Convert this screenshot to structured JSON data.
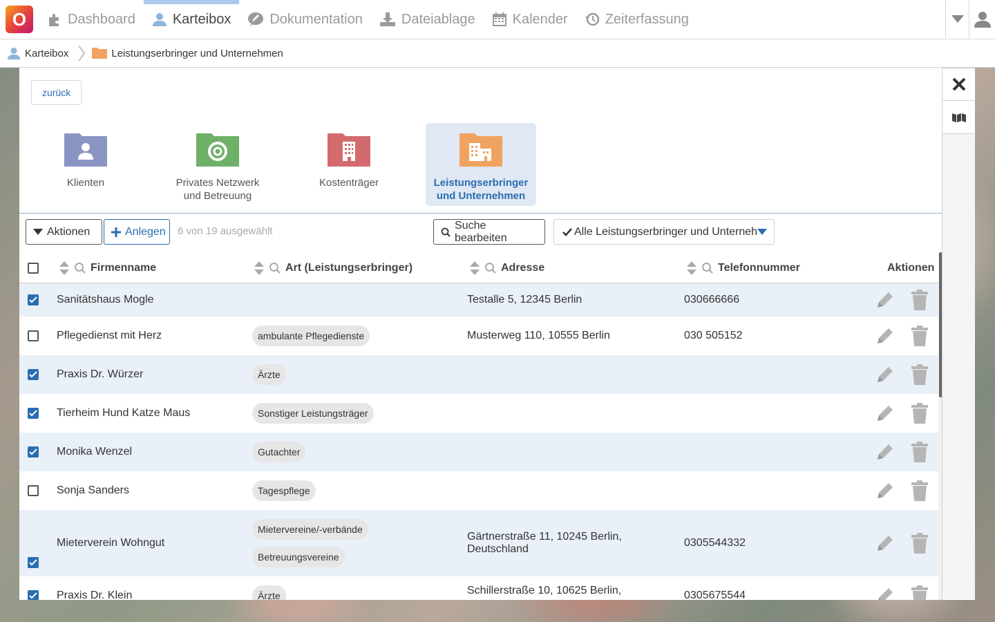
{
  "app": {
    "logo_letter": "O"
  },
  "topnav": {
    "items": [
      {
        "label": "Dashboard",
        "icon": "puzzle-icon"
      },
      {
        "label": "Karteibox",
        "icon": "user-icon",
        "active": true
      },
      {
        "label": "Dokumentation",
        "icon": "pencil-bubble-icon"
      },
      {
        "label": "Dateiablage",
        "icon": "download-icon"
      },
      {
        "label": "Kalender",
        "icon": "calendar-icon"
      },
      {
        "label": "Zeiterfassung",
        "icon": "history-icon"
      }
    ]
  },
  "breadcrumb": {
    "items": [
      {
        "label": "Karteibox"
      },
      {
        "label": "Leistungserbringer und Unternehmen"
      }
    ]
  },
  "back_label": "zurück",
  "categories": [
    {
      "label": "Klienten",
      "color": "#8a95c3"
    },
    {
      "label": "Privates Netzwerk und Betreuung",
      "color": "#6fb068"
    },
    {
      "label": "Kostenträger",
      "color": "#d36b6e"
    },
    {
      "label": "Leistungserbringer und Unternehmen",
      "color": "#f0a35e",
      "active": true
    }
  ],
  "toolbar": {
    "actions_label": "Aktionen",
    "create_label": "Anlegen",
    "selection_text": "6 von 19 ausgewählt",
    "search_label": "Suche bearbeiten",
    "filter_label": "Alle Leistungserbringer und Unterneh"
  },
  "table": {
    "headers": {
      "name": "Firmenname",
      "type": "Art (Leistungserbringer)",
      "address": "Adresse",
      "phone": "Telefonnummer",
      "actions": "Aktionen"
    },
    "rows": [
      {
        "checked": true,
        "name": "Sanitätshaus Mogle",
        "tags": [],
        "address": "Testalle 5, 12345 Berlin",
        "phone": "030666666"
      },
      {
        "checked": false,
        "name": "Pflegedienst mit Herz",
        "tags": [
          "ambulante Pflegedienste"
        ],
        "address": "Musterweg 110, 10555 Berlin",
        "phone": "030 505152"
      },
      {
        "checked": true,
        "name": "Praxis Dr. Würzer",
        "tags": [
          "Ärzte"
        ],
        "address": "",
        "phone": ""
      },
      {
        "checked": true,
        "name": "Tierheim Hund Katze Maus",
        "tags": [
          "Sonstiger Leistungsträger"
        ],
        "address": "",
        "phone": ""
      },
      {
        "checked": true,
        "name": "Monika Wenzel",
        "tags": [
          "Gutachter"
        ],
        "address": "",
        "phone": ""
      },
      {
        "checked": false,
        "name": "Sonja Sanders",
        "tags": [
          "Tagespflege"
        ],
        "address": "",
        "phone": ""
      },
      {
        "checked": true,
        "name": "Mieterverein Wohngut",
        "tags": [
          "Mietervereine/-verbände",
          "Betreuungsvereine"
        ],
        "address": "Gärtnerstraße 11, 10245 Berlin, Deutschland",
        "phone": "0305544332"
      },
      {
        "checked": true,
        "name": "Praxis Dr. Klein",
        "tags": [
          "Ärzte"
        ],
        "address": "Schillerstraße 10, 10625 Berlin,",
        "phone": "0305675544"
      }
    ]
  },
  "colors": {
    "accent": "#2a6db0",
    "row_alt": "#e9f0f8"
  }
}
